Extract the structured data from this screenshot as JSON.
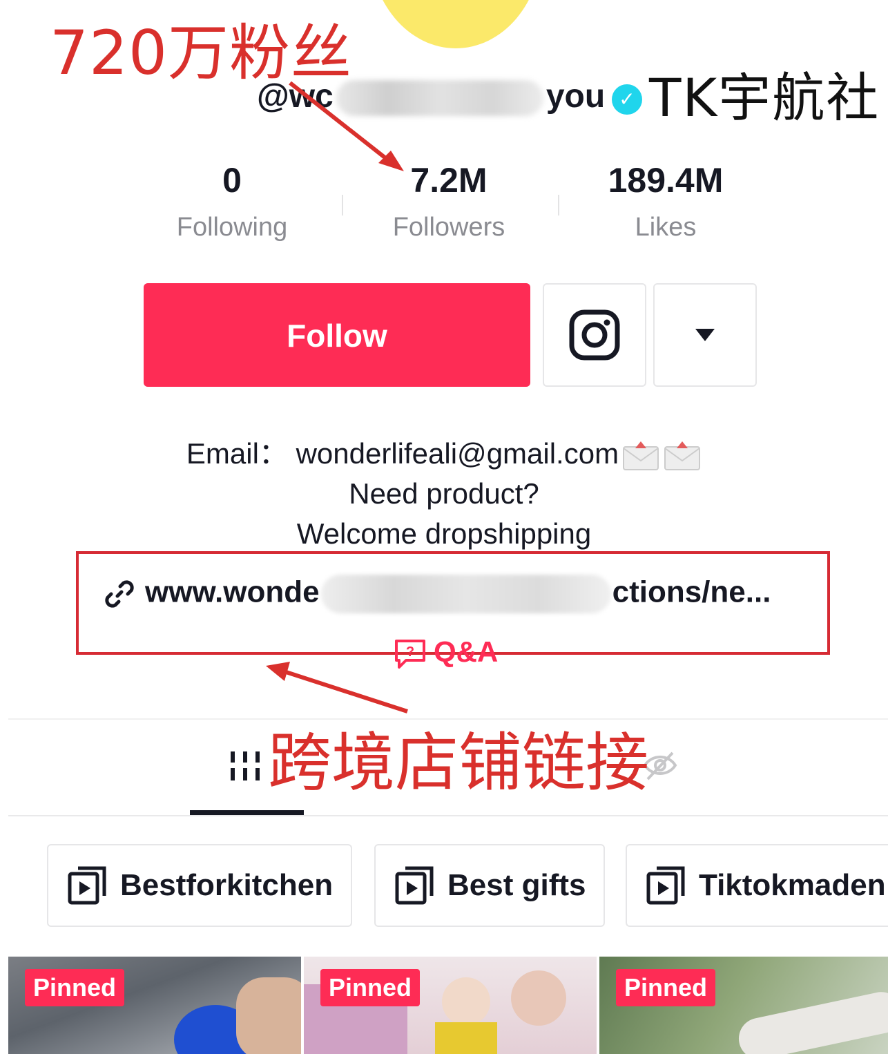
{
  "profile": {
    "handle_start": "@wc",
    "handle_end": "you",
    "watermark": "TK宇航社"
  },
  "annotations": {
    "followers_note": "720万粉丝",
    "shop_link_note": "跨境店铺链接"
  },
  "stats": [
    {
      "value": "0",
      "label": "Following"
    },
    {
      "value": "7.2M",
      "label": "Followers"
    },
    {
      "value": "189.4M",
      "label": "Likes"
    }
  ],
  "actions": {
    "follow_label": "Follow",
    "instagram_icon": "instagram-icon",
    "more_icon": "caret-down-icon"
  },
  "bio": {
    "email_line": "Email： wonderlifeali@gmail.com",
    "line2": "Need product?",
    "line3": "Welcome dropshipping"
  },
  "link": {
    "start": "www.wonde",
    "end": "ctions/ne..."
  },
  "qa": {
    "label": "Q&A"
  },
  "playlists": [
    {
      "label": "Bestforkitchen"
    },
    {
      "label": "Best gifts"
    },
    {
      "label": "Tiktokmaden"
    }
  ],
  "videos": [
    {
      "badge": "Pinned"
    },
    {
      "badge": "Pinned"
    },
    {
      "badge": "Pinned"
    }
  ],
  "colors": {
    "accent": "#fe2c55",
    "annotation": "#d9302c",
    "verified": "#20d5ec"
  }
}
